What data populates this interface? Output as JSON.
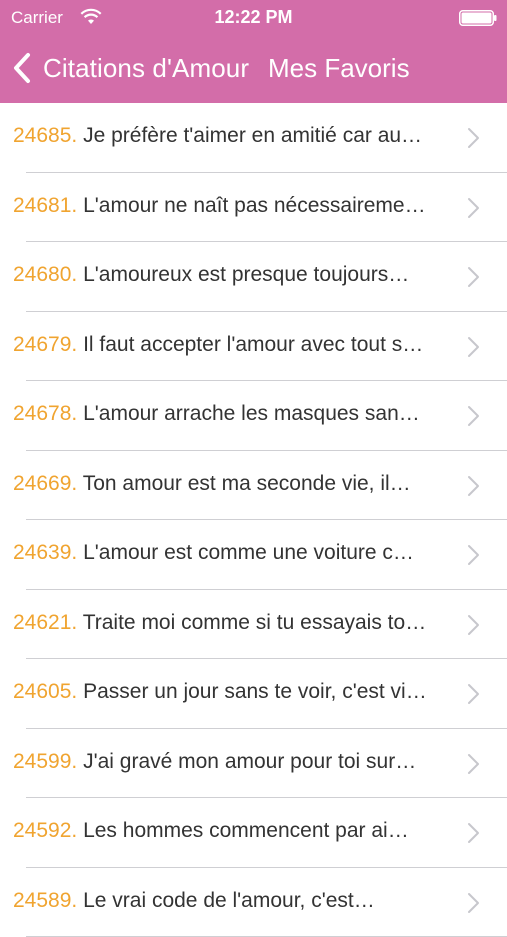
{
  "status_bar": {
    "carrier": "Carrier",
    "time": "12:22 PM"
  },
  "nav": {
    "back_label": "Citations d'Amour",
    "title": "Mes Favoris"
  },
  "colors": {
    "header": "#d36da9",
    "number": "#f0a430",
    "text": "#333333",
    "chevron": "#c7c7cc"
  },
  "icons": [
    "wifi-icon",
    "battery-icon",
    "back-chevron-icon",
    "chevron-right-icon"
  ],
  "favorites": [
    {
      "number": "24685.",
      "text": "Je préfère t'aimer en amitié car au…"
    },
    {
      "number": "24681.",
      "text": "L'amour ne naît pas nécessaireme…"
    },
    {
      "number": "24680.",
      "text": "L'amoureux est presque toujours…"
    },
    {
      "number": "24679.",
      "text": "Il faut accepter l'amour avec tout s…"
    },
    {
      "number": "24678.",
      "text": "L'amour arrache les masques san…"
    },
    {
      "number": "24669.",
      "text": "Ton amour est ma seconde vie, il…"
    },
    {
      "number": "24639.",
      "text": "L'amour est comme une voiture c…"
    },
    {
      "number": "24621.",
      "text": "Traite moi comme si tu essayais to…"
    },
    {
      "number": "24605.",
      "text": "Passer un jour sans te voir, c'est vi…"
    },
    {
      "number": "24599.",
      "text": "J'ai gravé mon amour pour toi sur…"
    },
    {
      "number": "24592.",
      "text": "Les hommes commencent par ai…"
    },
    {
      "number": "24589.",
      "text": "Le vrai code de l'amour, c'est…"
    }
  ]
}
